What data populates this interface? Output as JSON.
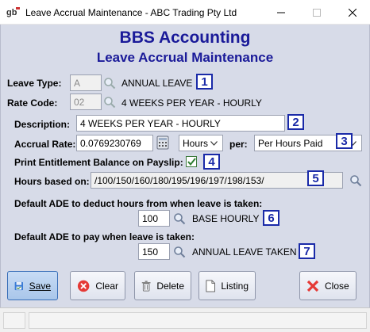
{
  "window": {
    "title": "Leave Accrual Maintenance - ABC Trading Pty Ltd"
  },
  "header": {
    "company": "BBS Accounting",
    "screen": "Leave Accrual Maintenance"
  },
  "leave_type": {
    "label": "Leave Type:",
    "code": "A",
    "description": "ANNUAL LEAVE",
    "badge": "1"
  },
  "rate_code": {
    "label": "Rate Code:",
    "code": "02",
    "description": "4 WEEKS PER YEAR - HOURLY"
  },
  "description": {
    "label": "Description:",
    "value": "4 WEEKS PER YEAR - HOURLY",
    "badge": "2"
  },
  "accrual_rate": {
    "label": "Accrual Rate:",
    "value": "0.0769230769",
    "unit": "Hours",
    "per_label": "per:",
    "per_value": "Per Hours Paid",
    "badge": "3"
  },
  "print_balance": {
    "label": "Print Entitlement Balance on Payslip:",
    "checked": true,
    "badge": "4"
  },
  "hours_based_on": {
    "label": "Hours based on:",
    "value": "/100/150/160/180/195/196/197/198/153/",
    "badge": "5"
  },
  "deduct_ade": {
    "label": "Default ADE to deduct hours from when leave is taken:",
    "code": "100",
    "description": "BASE HOURLY",
    "badge": "6"
  },
  "pay_ade": {
    "label": "Default ADE to pay when leave is taken:",
    "code": "150",
    "description": "ANNUAL LEAVE TAKEN",
    "badge": "7"
  },
  "buttons": {
    "save": "Save",
    "clear": "Clear",
    "delete": "Delete",
    "listing": "Listing",
    "close": "Close"
  },
  "colors": {
    "heading": "#1a1a99",
    "badge_border": "#1a2aa8",
    "client_bg": "#d7dbe8"
  },
  "icons": [
    "app-icon",
    "minimize-icon",
    "maximize-icon",
    "close-icon",
    "search-icon",
    "calculator-icon",
    "chevron-down-icon",
    "checkmark-icon",
    "save-icon",
    "clear-icon",
    "delete-icon",
    "listing-icon",
    "close-x-icon"
  ]
}
